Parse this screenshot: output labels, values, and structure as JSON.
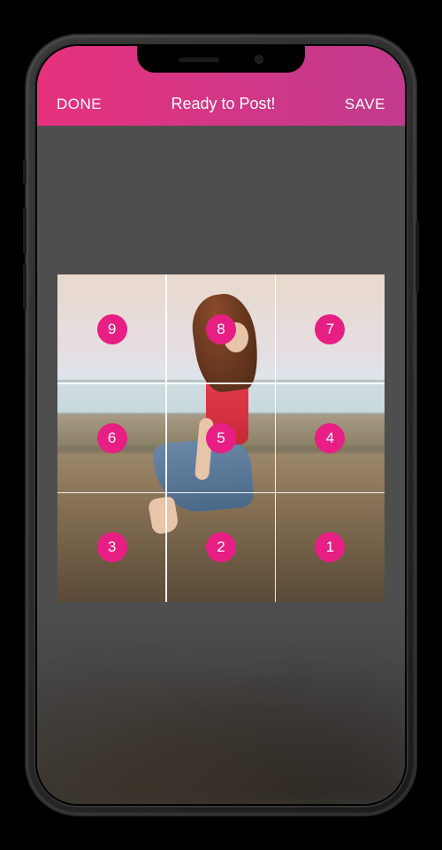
{
  "header": {
    "done_label": "DONE",
    "title": "Ready to Post!",
    "save_label": "SAVE"
  },
  "grid": {
    "cells": [
      {
        "number": "9"
      },
      {
        "number": "8"
      },
      {
        "number": "7"
      },
      {
        "number": "6"
      },
      {
        "number": "5"
      },
      {
        "number": "4"
      },
      {
        "number": "3"
      },
      {
        "number": "2"
      },
      {
        "number": "1"
      }
    ]
  },
  "colors": {
    "accent": "#e71e83",
    "header_gradient_start": "#e6317e",
    "header_gradient_end": "#c13b8e"
  }
}
